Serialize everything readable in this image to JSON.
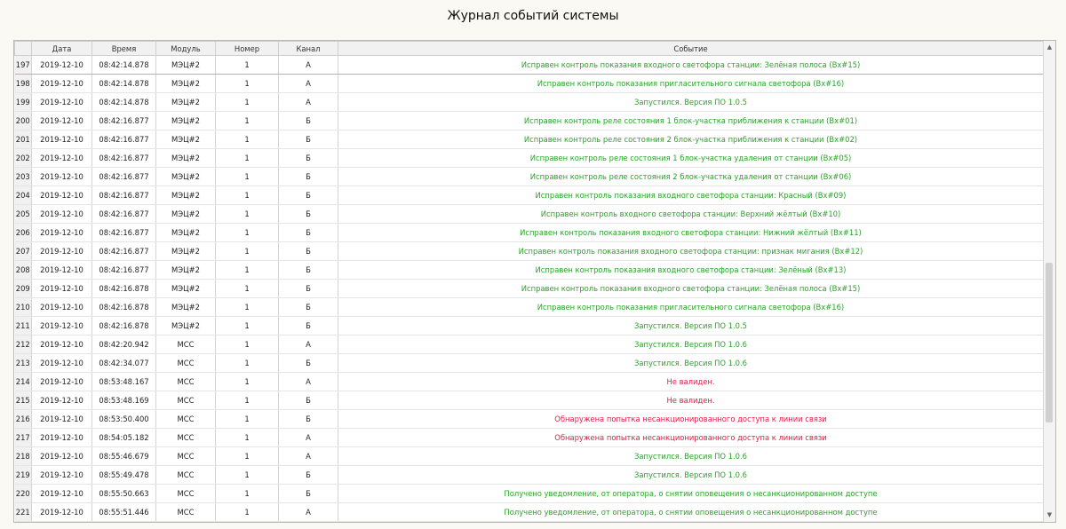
{
  "page_title": "Журнал событий системы",
  "colors": {
    "ok": "#2aa32a",
    "alert": "#e01e46"
  },
  "scroll_icons": {
    "up": "▲",
    "down": "▼"
  },
  "columns": [
    "Дата",
    "Время",
    "Модуль",
    "Номер",
    "Канал",
    "Событие"
  ],
  "rows": [
    {
      "n": "197",
      "date": "2019-12-10",
      "time": "08:42:14.878",
      "module": "МЭЦ#2",
      "num": "1",
      "ch": "А",
      "event": "Исправен контроль показания входного светофора станции: Зелёная полоса (Вх#15)",
      "status": "ok"
    },
    {
      "n": "198",
      "date": "2019-12-10",
      "time": "08:42:14.878",
      "module": "МЭЦ#2",
      "num": "1",
      "ch": "А",
      "event": "Исправен контроль показания пригласительного сигнала светофора (Вх#16)",
      "status": "ok"
    },
    {
      "n": "199",
      "date": "2019-12-10",
      "time": "08:42:14.878",
      "module": "МЭЦ#2",
      "num": "1",
      "ch": "А",
      "event": "Запустился. Версия ПО 1.0.5",
      "status": "ok"
    },
    {
      "n": "200",
      "date": "2019-12-10",
      "time": "08:42:16.877",
      "module": "МЭЦ#2",
      "num": "1",
      "ch": "Б",
      "event": "Исправен контроль реле состояния 1 блок-участка приближения к станции (Вх#01)",
      "status": "ok"
    },
    {
      "n": "201",
      "date": "2019-12-10",
      "time": "08:42:16.877",
      "module": "МЭЦ#2",
      "num": "1",
      "ch": "Б",
      "event": "Исправен контроль реле состояния 2 блок-участка приближения к станции (Вх#02)",
      "status": "ok"
    },
    {
      "n": "202",
      "date": "2019-12-10",
      "time": "08:42:16.877",
      "module": "МЭЦ#2",
      "num": "1",
      "ch": "Б",
      "event": "Исправен контроль реле состояния 1 блок-участка удаления от станции (Вх#05)",
      "status": "ok"
    },
    {
      "n": "203",
      "date": "2019-12-10",
      "time": "08:42:16.877",
      "module": "МЭЦ#2",
      "num": "1",
      "ch": "Б",
      "event": "Исправен контроль реле состояния 2 блок-участка удаления от станции (Вх#06)",
      "status": "ok"
    },
    {
      "n": "204",
      "date": "2019-12-10",
      "time": "08:42:16.877",
      "module": "МЭЦ#2",
      "num": "1",
      "ch": "Б",
      "event": "Исправен контроль показания входного светофора станции: Красный (Вх#09)",
      "status": "ok"
    },
    {
      "n": "205",
      "date": "2019-12-10",
      "time": "08:42:16.877",
      "module": "МЭЦ#2",
      "num": "1",
      "ch": "Б",
      "event": "Исправен контроль входного светофора станции: Верхний жёлтый (Вх#10)",
      "status": "ok"
    },
    {
      "n": "206",
      "date": "2019-12-10",
      "time": "08:42:16.877",
      "module": "МЭЦ#2",
      "num": "1",
      "ch": "Б",
      "event": "Исправен контроль показания входного светофора станции: Нижний жёлтый (Вх#11)",
      "status": "ok"
    },
    {
      "n": "207",
      "date": "2019-12-10",
      "time": "08:42:16.877",
      "module": "МЭЦ#2",
      "num": "1",
      "ch": "Б",
      "event": "Исправен контроль показания входного светофора станции: признак мигания (Вх#12)",
      "status": "ok"
    },
    {
      "n": "208",
      "date": "2019-12-10",
      "time": "08:42:16.877",
      "module": "МЭЦ#2",
      "num": "1",
      "ch": "Б",
      "event": "Исправен контроль показания входного светофора станции: Зелёный (Вх#13)",
      "status": "ok"
    },
    {
      "n": "209",
      "date": "2019-12-10",
      "time": "08:42:16.878",
      "module": "МЭЦ#2",
      "num": "1",
      "ch": "Б",
      "event": "Исправен контроль показания входного светофора станции: Зелёная полоса (Вх#15)",
      "status": "ok"
    },
    {
      "n": "210",
      "date": "2019-12-10",
      "time": "08:42:16.878",
      "module": "МЭЦ#2",
      "num": "1",
      "ch": "Б",
      "event": "Исправен контроль показания пригласительного сигнала светофора (Вх#16)",
      "status": "ok"
    },
    {
      "n": "211",
      "date": "2019-12-10",
      "time": "08:42:16.878",
      "module": "МЭЦ#2",
      "num": "1",
      "ch": "Б",
      "event": "Запустился. Версия ПО 1.0.5",
      "status": "ok"
    },
    {
      "n": "212",
      "date": "2019-12-10",
      "time": "08:42:20.942",
      "module": "МСС",
      "num": "1",
      "ch": "А",
      "event": "Запустился. Версия ПО 1.0.6",
      "status": "ok"
    },
    {
      "n": "213",
      "date": "2019-12-10",
      "time": "08:42:34.077",
      "module": "МСС",
      "num": "1",
      "ch": "Б",
      "event": "Запустился. Версия ПО 1.0.6",
      "status": "ok"
    },
    {
      "n": "214",
      "date": "2019-12-10",
      "time": "08:53:48.167",
      "module": "МСС",
      "num": "1",
      "ch": "А",
      "event": "Не валиден.",
      "status": "alert"
    },
    {
      "n": "215",
      "date": "2019-12-10",
      "time": "08:53:48.169",
      "module": "МСС",
      "num": "1",
      "ch": "Б",
      "event": "Не валиден.",
      "status": "alert"
    },
    {
      "n": "216",
      "date": "2019-12-10",
      "time": "08:53:50.400",
      "module": "МСС",
      "num": "1",
      "ch": "Б",
      "event": "Обнаружена попытка несанкционированного доступа к линии связи",
      "status": "alert"
    },
    {
      "n": "217",
      "date": "2019-12-10",
      "time": "08:54:05.182",
      "module": "МСС",
      "num": "1",
      "ch": "А",
      "event": "Обнаружена попытка несанкционированного доступа к линии связи",
      "status": "alert"
    },
    {
      "n": "218",
      "date": "2019-12-10",
      "time": "08:55:46.679",
      "module": "МСС",
      "num": "1",
      "ch": "А",
      "event": "Запустился. Версия ПО 1.0.6",
      "status": "ok"
    },
    {
      "n": "219",
      "date": "2019-12-10",
      "time": "08:55:49.478",
      "module": "МСС",
      "num": "1",
      "ch": "Б",
      "event": "Запустился. Версия ПО 1.0.6",
      "status": "ok"
    },
    {
      "n": "220",
      "date": "2019-12-10",
      "time": "08:55:50.663",
      "module": "МСС",
      "num": "1",
      "ch": "Б",
      "event": "Получено уведомление, от оператора, о снятии оповещения о несанкционированном доступе",
      "status": "ok"
    },
    {
      "n": "221",
      "date": "2019-12-10",
      "time": "08:55:51.446",
      "module": "МСС",
      "num": "1",
      "ch": "А",
      "event": "Получено уведомление, от оператора, о снятии оповещения о несанкционированном доступе",
      "status": "ok"
    }
  ]
}
